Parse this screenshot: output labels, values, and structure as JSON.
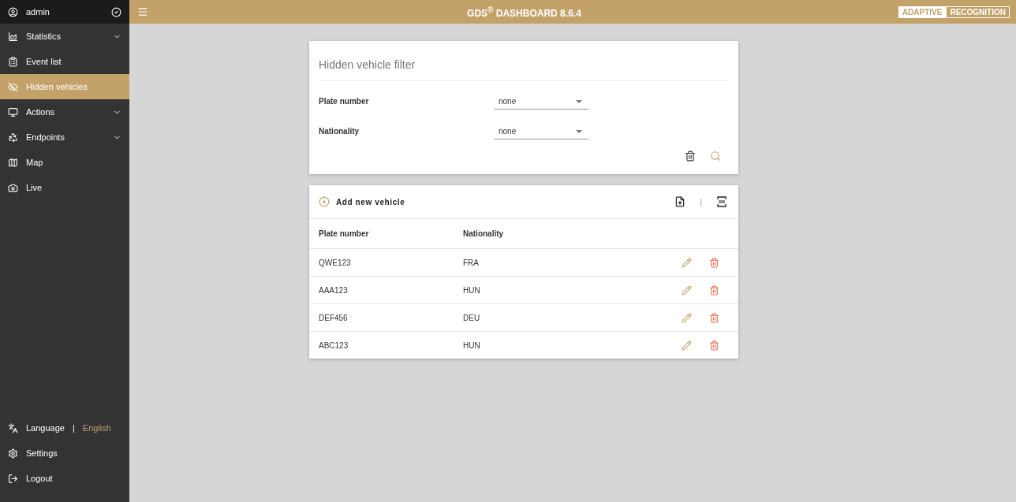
{
  "user": {
    "name": "admin"
  },
  "sidebar": {
    "items": [
      {
        "label": "Statistics",
        "expandable": true,
        "selected": false
      },
      {
        "label": "Event list",
        "expandable": false,
        "selected": false
      },
      {
        "label": "Hidden vehicles",
        "expandable": false,
        "selected": true
      },
      {
        "label": "Actions",
        "expandable": true,
        "selected": false
      },
      {
        "label": "Endpoints",
        "expandable": true,
        "selected": false
      },
      {
        "label": "Map",
        "expandable": false,
        "selected": false
      },
      {
        "label": "Live",
        "expandable": false,
        "selected": false
      }
    ],
    "language": {
      "label": "Language",
      "separator": "|",
      "value": "English"
    },
    "footer_items": [
      {
        "label": "Settings"
      },
      {
        "label": "Logout"
      }
    ]
  },
  "header": {
    "title": "GDS$^{®}$ DASHBOARD 8.6.4",
    "logo": [
      "ADAPTIVE",
      "RECOGNITION"
    ]
  },
  "filter": {
    "title": "Hidden vehicle filter",
    "fields": [
      {
        "label": "Plate number",
        "value": "none"
      },
      {
        "label": "Nationality",
        "value": "none"
      }
    ]
  },
  "table": {
    "add_label": "Add new vehicle",
    "separator": "|",
    "columns": [
      "Plate number",
      "Nationality"
    ],
    "rows": [
      [
        "QWE123",
        "FRA"
      ],
      [
        "AAA123",
        "HUN"
      ],
      [
        "DEF456",
        "DEU"
      ],
      [
        "ABC123",
        "HUN"
      ]
    ]
  }
}
